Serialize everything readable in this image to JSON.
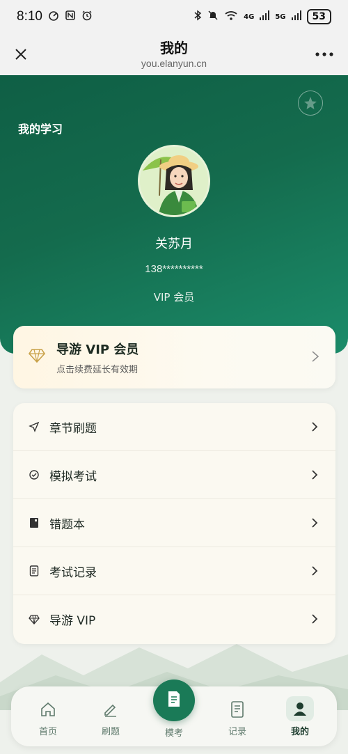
{
  "status_bar": {
    "time": "8:10",
    "network_4g": "4G",
    "network_5g": "5G",
    "battery": "53"
  },
  "nav": {
    "title": "我的",
    "url": "you.elanyun.cn"
  },
  "hero": {
    "heading": "我的学习",
    "user_name": "关苏月",
    "phone": "138**********",
    "level": "VIP 会员"
  },
  "vip_card": {
    "title": "导游 VIP 会员",
    "subtitle": "点击续费延长有效期"
  },
  "menu": [
    {
      "label": "章节刷题",
      "icon": "send-icon"
    },
    {
      "label": "模拟考试",
      "icon": "check-circle-icon"
    },
    {
      "label": "错题本",
      "icon": "notebook-icon"
    },
    {
      "label": "考试记录",
      "icon": "document-icon"
    },
    {
      "label": "导游 VIP",
      "icon": "diamond-icon"
    }
  ],
  "tabs": [
    {
      "label": "首页",
      "icon": "home-icon"
    },
    {
      "label": "刷题",
      "icon": "pencil-icon"
    },
    {
      "label": "模考",
      "icon": "exam-icon"
    },
    {
      "label": "记录",
      "icon": "list-icon"
    },
    {
      "label": "我的",
      "icon": "person-icon"
    }
  ],
  "colors": {
    "primary": "#146b4d",
    "accent": "#1a7a57",
    "vip_gold": "#c9a24a"
  }
}
